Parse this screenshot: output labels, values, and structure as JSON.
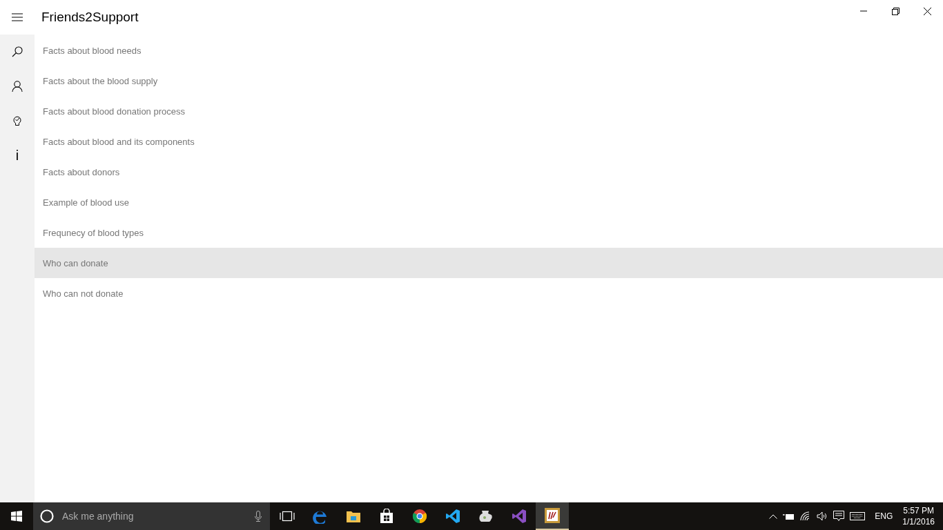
{
  "app": {
    "title": "Friends2Support"
  },
  "nav": [
    {
      "kind": "search"
    },
    {
      "kind": "person"
    },
    {
      "kind": "bulb"
    },
    {
      "kind": "info",
      "glyph": "i"
    }
  ],
  "topics": [
    {
      "label": "Facts about blood needs",
      "selected": false
    },
    {
      "label": "Facts about the blood supply",
      "selected": false
    },
    {
      "label": "Facts about blood donation process",
      "selected": false
    },
    {
      "label": "Facts about blood and its components",
      "selected": false
    },
    {
      "label": "Facts about donors",
      "selected": false
    },
    {
      "label": "Example of blood use",
      "selected": false
    },
    {
      "label": "Frequnecy of blood types",
      "selected": false
    },
    {
      "label": "Who can donate",
      "selected": true
    },
    {
      "label": "Who can not donate",
      "selected": false
    }
  ],
  "taskbar": {
    "search": {
      "placeholder": "Ask me anything"
    },
    "apps": [
      {
        "kind": "taskview",
        "selected": false
      },
      {
        "kind": "edge",
        "selected": false
      },
      {
        "kind": "folder",
        "selected": false
      },
      {
        "kind": "store",
        "selected": false
      },
      {
        "kind": "chrome",
        "selected": false
      },
      {
        "kind": "vscode",
        "selected": false
      },
      {
        "kind": "jug",
        "selected": false
      },
      {
        "kind": "vs",
        "selected": false
      },
      {
        "kind": "app",
        "selected": true
      }
    ],
    "language": "ENG",
    "time": "5:57 PM",
    "date": "1/1/2016"
  }
}
